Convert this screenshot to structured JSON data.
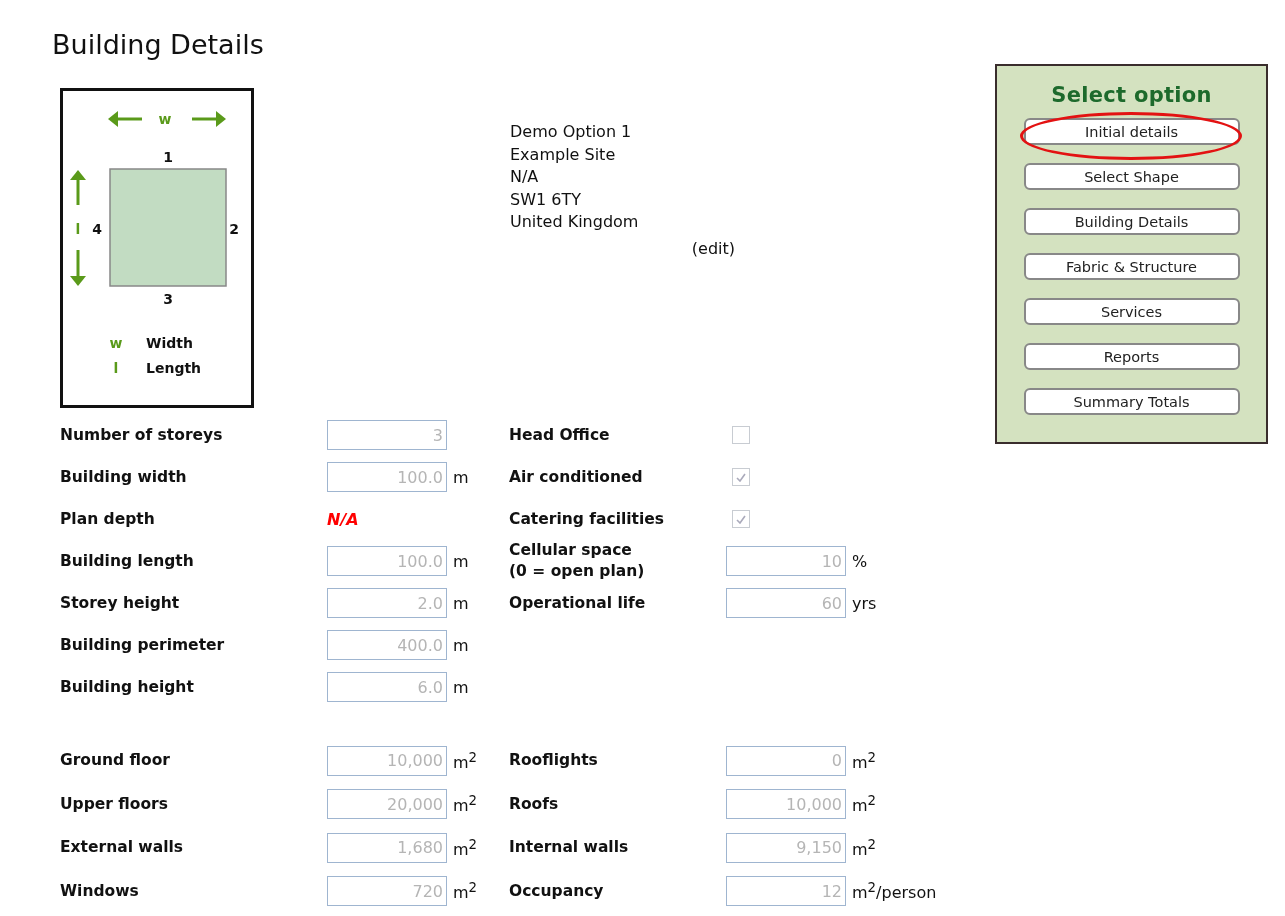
{
  "page": {
    "title": "Building Details"
  },
  "diagram": {
    "width_symbol": "w",
    "length_symbol": "l",
    "sides": [
      "1",
      "2",
      "3",
      "4"
    ],
    "legend": [
      {
        "symbol": "w",
        "label": "Width"
      },
      {
        "symbol": "l",
        "label": "Length"
      }
    ]
  },
  "site": {
    "lines": [
      "Demo Option 1",
      "Example Site",
      "N/A",
      "SW1 6TY",
      "United Kingdom"
    ],
    "edit_link": "(edit)"
  },
  "sections": [
    {
      "rows": [
        {
          "left": {
            "kind": "input",
            "label": "Number of storeys",
            "value": "3",
            "disabled": true
          },
          "right": {
            "kind": "checkbox",
            "label": "Head Office",
            "checked": false,
            "disabled": true
          }
        },
        {
          "left": {
            "kind": "input",
            "label": "Building width",
            "value": "100.0",
            "unit": "m",
            "disabled": true
          },
          "right": {
            "kind": "checkbox",
            "label": "Air conditioned",
            "checked": true,
            "disabled": true
          }
        },
        {
          "left": {
            "kind": "warning",
            "label": "Plan depth",
            "value": "N/A"
          },
          "right": {
            "kind": "checkbox",
            "label": "Catering facilities",
            "checked": true,
            "disabled": true
          }
        },
        {
          "left": {
            "kind": "input",
            "label": "Building length",
            "value": "100.0",
            "unit": "m",
            "disabled": true
          },
          "right": {
            "kind": "input",
            "label": "Cellular space\n(0 = open plan)",
            "value": "10",
            "unit": "%",
            "disabled": true
          }
        },
        {
          "left": {
            "kind": "input",
            "label": "Storey height",
            "value": "2.0",
            "unit": "m",
            "disabled": true
          },
          "right": {
            "kind": "input",
            "label": "Operational life",
            "value": "60",
            "unit": "yrs",
            "disabled": true
          }
        },
        {
          "left": {
            "kind": "input",
            "label": "Building perimeter",
            "value": "400.0",
            "unit": "m",
            "disabled": true
          }
        },
        {
          "left": {
            "kind": "input",
            "label": "Building height",
            "value": "6.0",
            "unit": "m",
            "disabled": true
          }
        }
      ]
    },
    {
      "rows": [
        {
          "left": {
            "kind": "input",
            "label": "Ground floor",
            "value": "10,000",
            "unit": "m$^{2}$",
            "disabled": true
          },
          "right": {
            "kind": "input",
            "label": "Rooflights",
            "value": "0",
            "unit": "m$^{2}$",
            "disabled": true
          }
        },
        {
          "left": {
            "kind": "input",
            "label": "Upper floors",
            "value": "20,000",
            "unit": "m$^{2}$",
            "disabled": true
          },
          "right": {
            "kind": "input",
            "label": "Roofs",
            "value": "10,000",
            "unit": "m$^{2}$",
            "disabled": true
          }
        },
        {
          "left": {
            "kind": "input",
            "label": "External walls",
            "value": "1,680",
            "unit": "m$^{2}$",
            "disabled": true
          },
          "right": {
            "kind": "input",
            "label": "Internal walls",
            "value": "9,150",
            "unit": "m$^{2}$",
            "disabled": true
          }
        },
        {
          "left": {
            "kind": "input",
            "label": "Windows",
            "value": "720",
            "unit": "m$^{2}$",
            "disabled": true
          },
          "right": {
            "kind": "input",
            "label": "Occupancy",
            "value": "12",
            "unit": "m$^{2}$/person",
            "disabled": true
          }
        }
      ]
    }
  ],
  "options_panel": {
    "title": "Select option",
    "buttons": [
      {
        "label": "Initial details",
        "highlighted": true
      },
      {
        "label": "Select Shape",
        "highlighted": false
      },
      {
        "label": "Building Details",
        "highlighted": false
      },
      {
        "label": "Fabric & Structure",
        "highlighted": false
      },
      {
        "label": "Services",
        "highlighted": false
      },
      {
        "label": "Reports",
        "highlighted": false
      },
      {
        "label": "Summary Totals",
        "highlighted": false
      }
    ]
  }
}
